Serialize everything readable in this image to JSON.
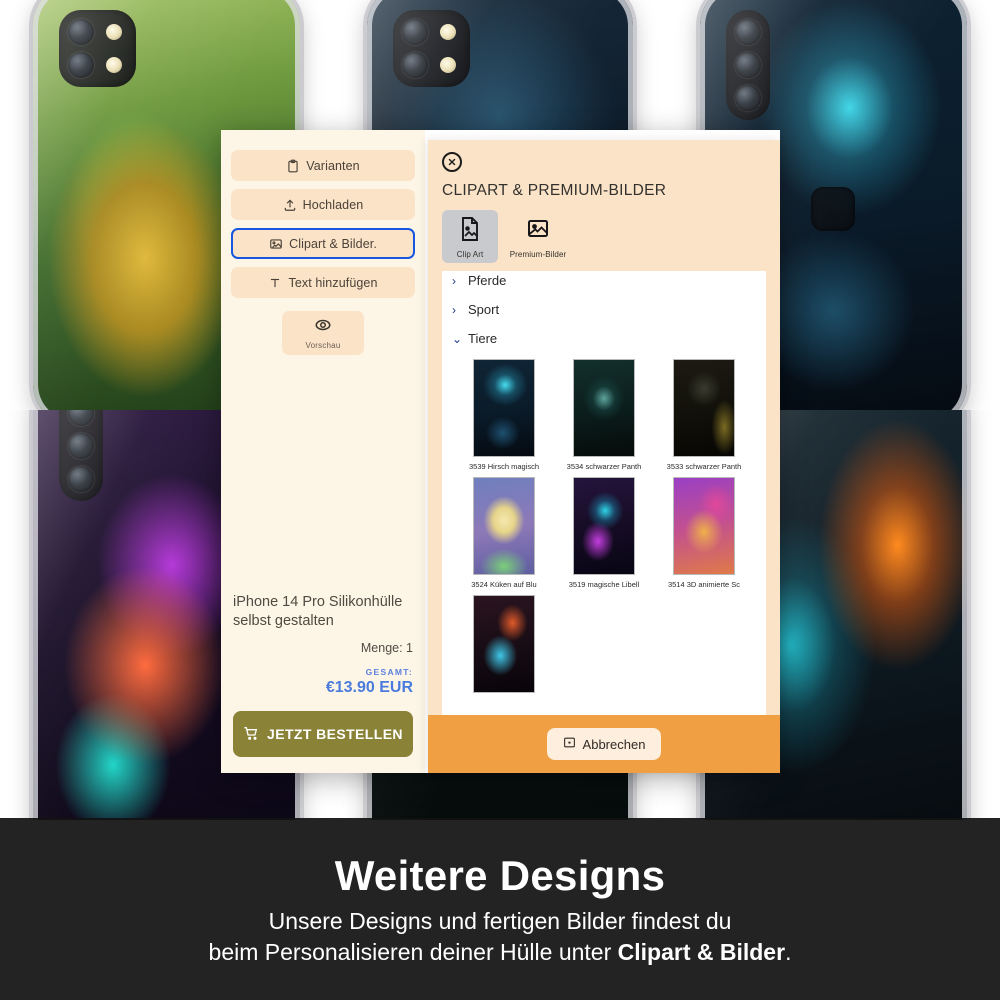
{
  "background": {
    "cases": [
      {
        "name": "lizard-dragon-case",
        "art": "art-lizard",
        "cameras": "two"
      },
      {
        "name": "dark-forest-case",
        "art": "art-forest",
        "cameras": "two"
      },
      {
        "name": "magic-deer-case",
        "art": "art-deer",
        "cameras": "vert"
      },
      {
        "name": "neon-mushroom-case",
        "art": "art-mushroom",
        "cameras": "vert"
      },
      {
        "name": "dark-figure-case",
        "art": "art-dark",
        "cameras": "none"
      },
      {
        "name": "fire-ice-tiger-case",
        "art": "art-tiger",
        "cameras": "vert"
      }
    ]
  },
  "sidebar": {
    "buttons": [
      {
        "label": "Varianten",
        "icon": "clipboard-icon",
        "active": false
      },
      {
        "label": "Hochladen",
        "icon": "upload-icon",
        "active": false
      },
      {
        "label": "Clipart & Bilder.",
        "icon": "image-icon",
        "active": true
      },
      {
        "label": "Text hinzufügen",
        "icon": "text-icon",
        "active": false
      }
    ],
    "preview": {
      "label": "Vorschau",
      "icon": "eye-icon"
    },
    "product_title": "iPhone 14 Pro Silikonhülle selbst gestalten",
    "quantity": "Menge: 1",
    "total_label": "GESAMT:",
    "total_value": "€13.90 EUR",
    "order_button": "JETZT BESTELLEN"
  },
  "modal": {
    "title": "CLIPART & PREMIUM-BILDER",
    "close_icon": "close-icon",
    "tabs": [
      {
        "label": "Clip Art",
        "icon": "clipart-icon",
        "selected": true
      },
      {
        "label": "Premium-Bilder",
        "icon": "picture-icon",
        "selected": false
      }
    ],
    "categories": [
      {
        "label": "Pferde",
        "expanded": false,
        "chevron": "›"
      },
      {
        "label": "Sport",
        "expanded": false,
        "chevron": "›"
      },
      {
        "label": "Tiere",
        "expanded": true,
        "chevron": "⌄"
      }
    ],
    "thumbnails": [
      {
        "label": "3539 Hirsch magisch",
        "art": "t-deer"
      },
      {
        "label": "3534 schwarzer Panth",
        "art": "t-wolf"
      },
      {
        "label": "3533 schwarzer Panth",
        "art": "t-panther"
      },
      {
        "label": "3524 Küken auf Blu",
        "art": "t-chick"
      },
      {
        "label": "3519 magische Libell",
        "art": "t-dragonfly"
      },
      {
        "label": "3514 3D animierte Sc",
        "art": "t-snail"
      }
    ],
    "partial_thumbnail": {
      "label": "",
      "art": "t-peacock"
    },
    "cancel_button": "Abbrechen"
  },
  "banner": {
    "title": "Weitere Designs",
    "line1": "Unsere Designs und fertigen Bilder findest du",
    "line2_prefix": "beim Personalisieren deiner Hülle unter ",
    "line2_bold": "Clipart & Bilder",
    "line2_suffix": "."
  },
  "colors": {
    "panel_bg": "#fdf6e6",
    "button_bg": "#fbe3c8",
    "modal_bg": "#fbe3c8",
    "footer_orange": "#f0a042",
    "order_olive": "#8a8236",
    "accent_blue": "#1756e0",
    "price_blue": "#4a7bdd"
  }
}
